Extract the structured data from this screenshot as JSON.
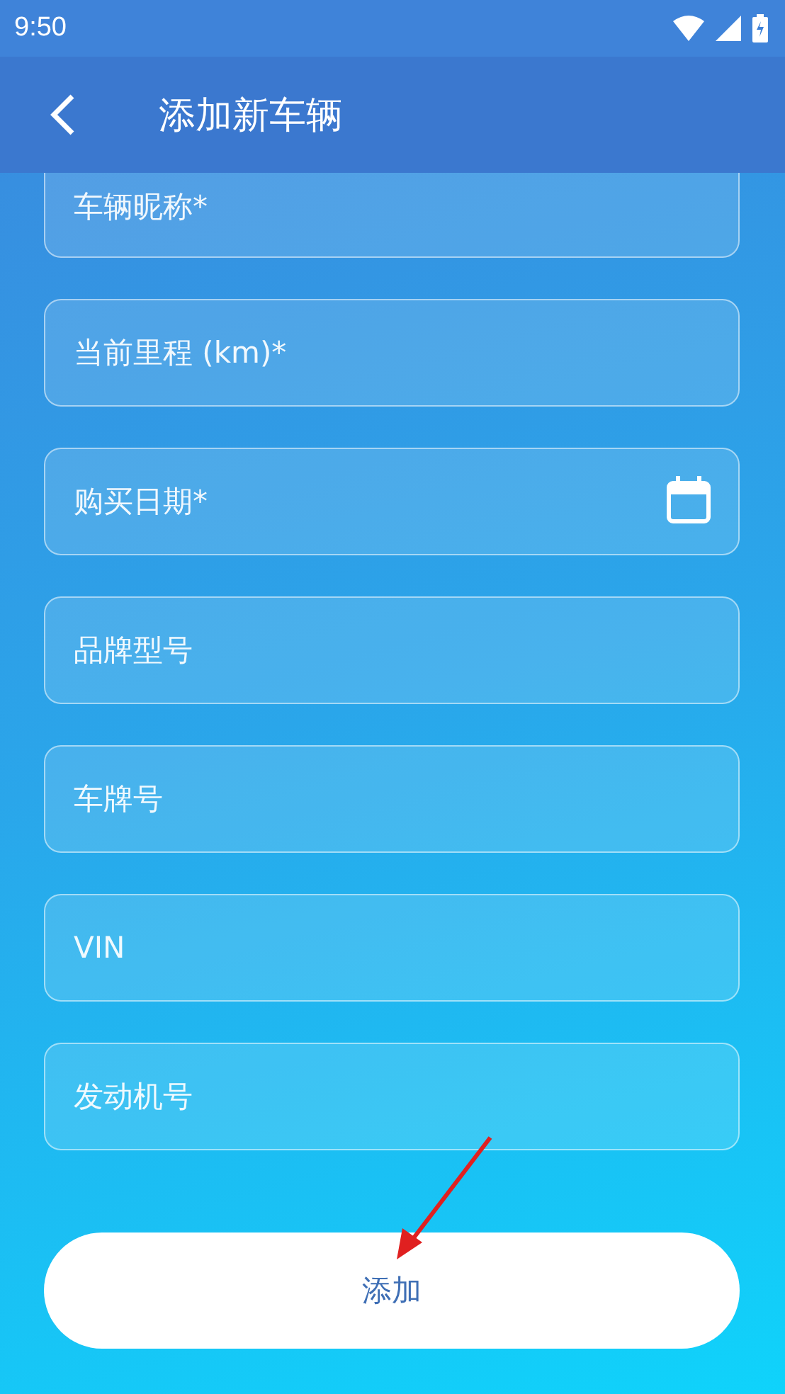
{
  "status_bar": {
    "time": "9:50"
  },
  "app_bar": {
    "title": "添加新车辆"
  },
  "fields": [
    {
      "kind": "text",
      "placeholder": "车辆昵称*"
    },
    {
      "kind": "text",
      "placeholder": "当前里程 (km)*"
    },
    {
      "kind": "date",
      "placeholder": "购买日期*"
    },
    {
      "kind": "text",
      "placeholder": "品牌型号"
    },
    {
      "kind": "text",
      "placeholder": "车牌号"
    },
    {
      "kind": "text",
      "placeholder": "VIN"
    },
    {
      "kind": "text",
      "placeholder": "发动机号"
    }
  ],
  "submit_button": {
    "label": "添加"
  }
}
